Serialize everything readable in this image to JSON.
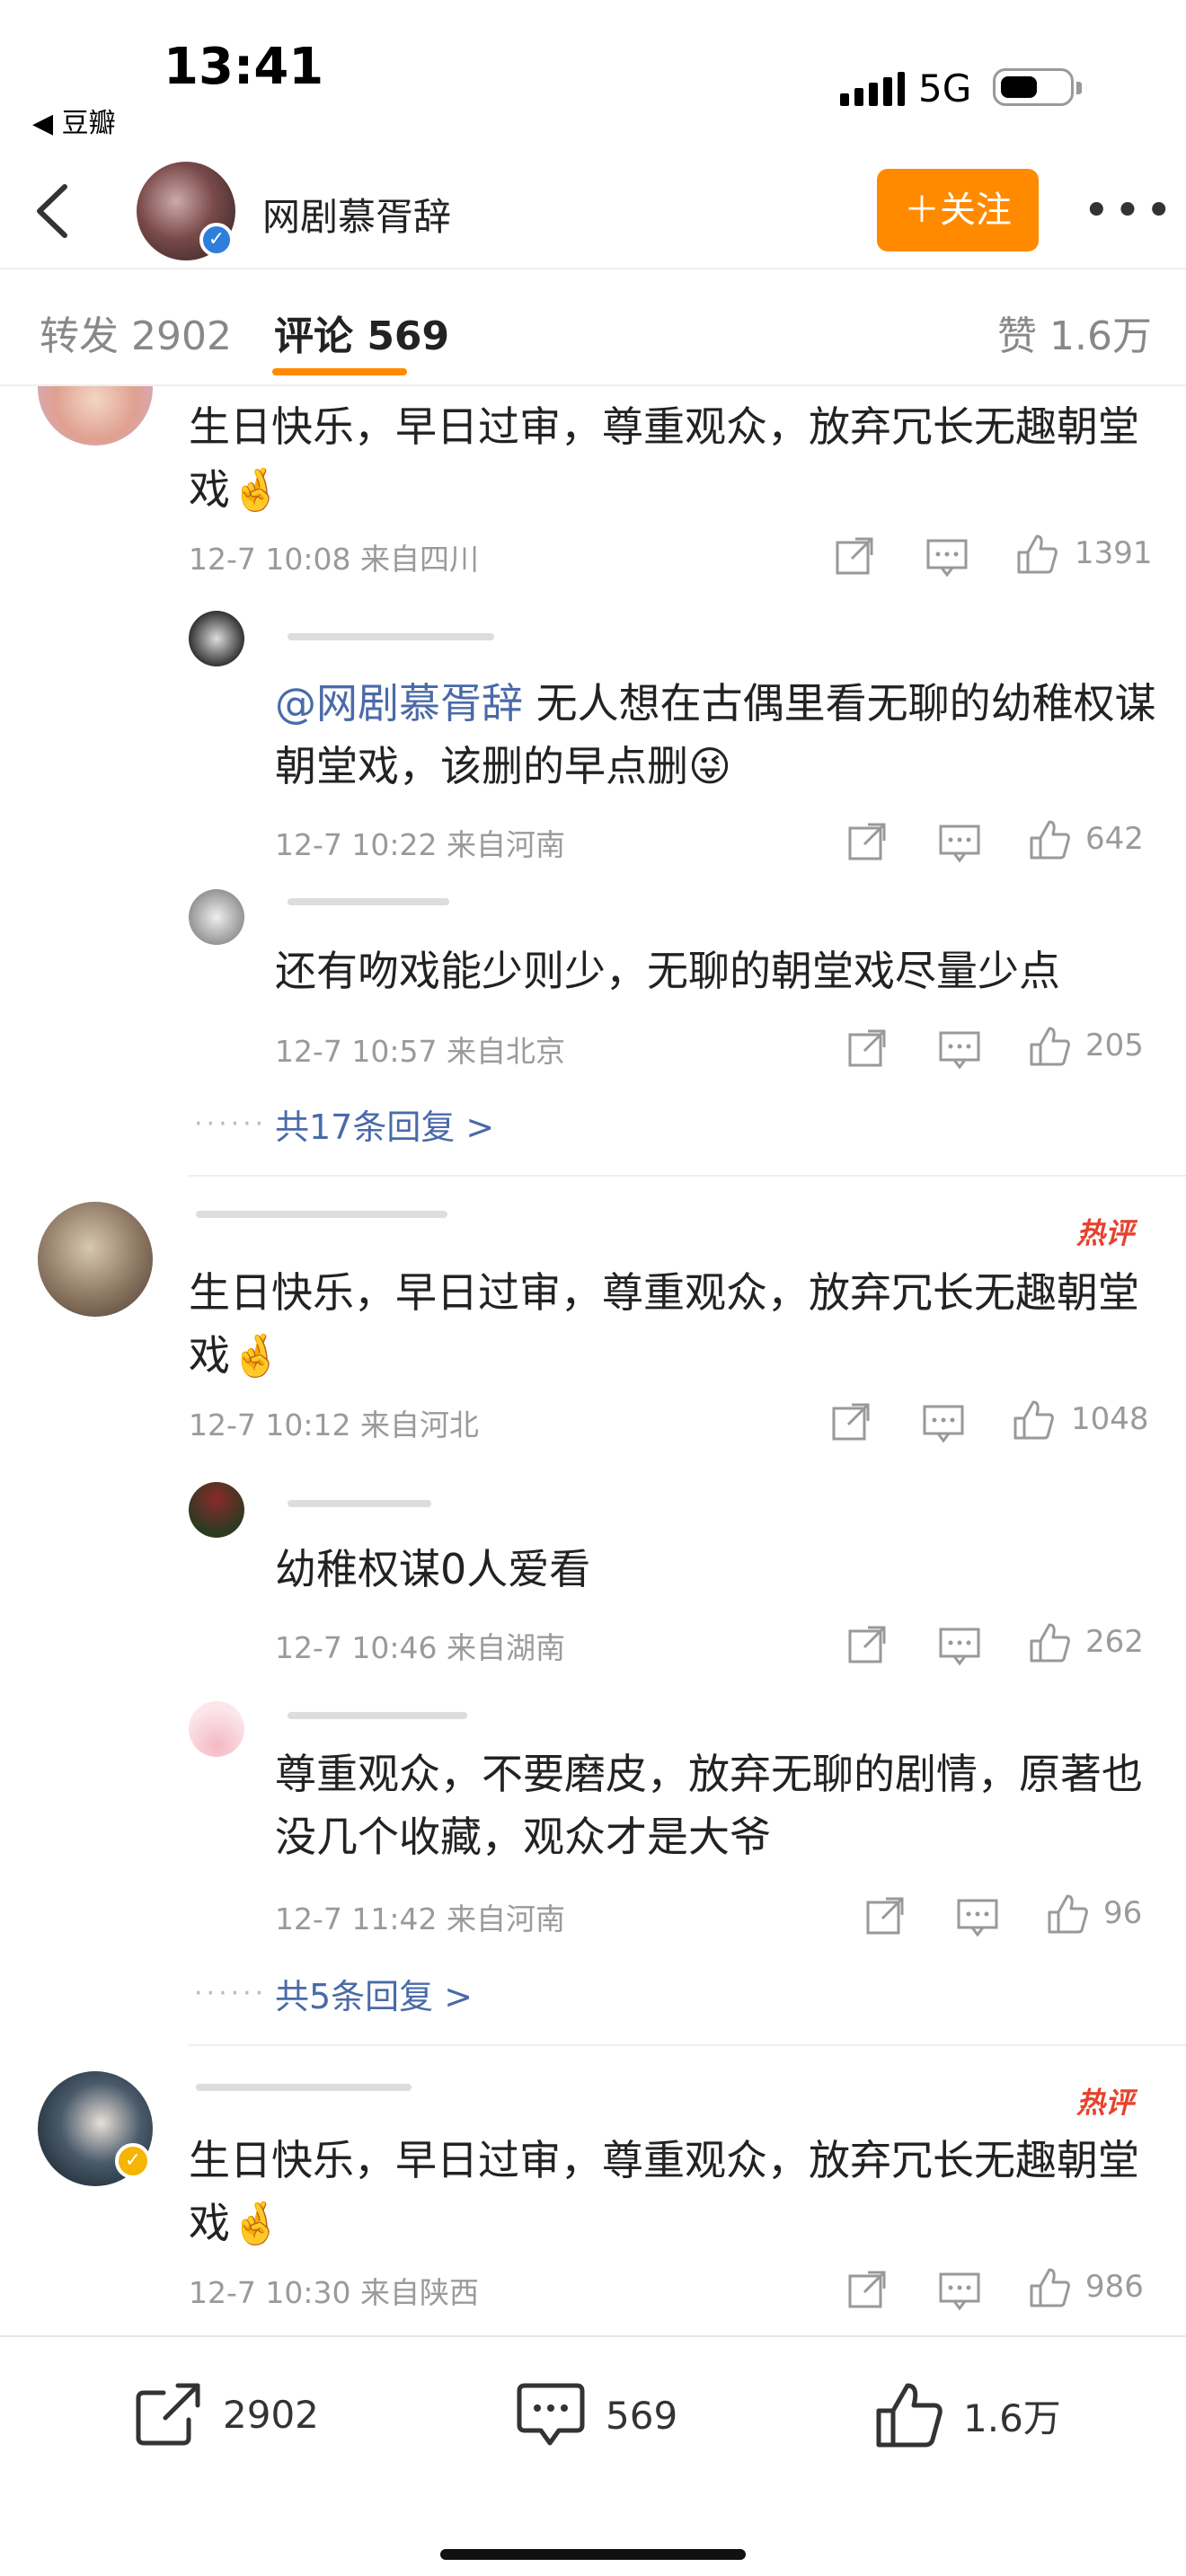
{
  "status_bar": {
    "time": "13:41",
    "back_app": "◀ 豆瓣",
    "network": "5G"
  },
  "nav": {
    "title": "网剧慕胥辞",
    "follow_label": "＋关注",
    "more_label": "•••"
  },
  "tabs": {
    "repost": "转发 2902",
    "comments": "评论 569",
    "likes": "赞 1.6万"
  },
  "comments": [
    {
      "text": "生日快乐，早日过审，尊重观众，放弃冗长无趣朝堂戏🤞",
      "meta": "12-7 10:08  来自四川",
      "likes": "1391",
      "replies": [
        {
          "mention": "@网剧慕胥辞",
          "text": " 无人想在古偶里看无聊的幼稚权谋朝堂戏，该删的早点删😜",
          "meta": "12-7 10:22  来自河南",
          "likes": "642"
        },
        {
          "mention": "",
          "text": "还有吻戏能少则少，无聊的朝堂戏尽量少点",
          "meta": "12-7 10:57  来自北京",
          "likes": "205"
        }
      ],
      "more_replies": "共17条回复 >"
    },
    {
      "hot": "热评",
      "text": "生日快乐，早日过审，尊重观众，放弃冗长无趣朝堂戏🤞",
      "meta": "12-7 10:12  来自河北",
      "likes": "1048",
      "replies": [
        {
          "mention": "",
          "text": "幼稚权谋0人爱看",
          "meta": "12-7 10:46  来自湖南",
          "likes": "262"
        },
        {
          "mention": "",
          "text": "尊重观众，不要磨皮，放弃无聊的剧情，原著也没几个收藏，观众才是大爷",
          "meta": "12-7 11:42  来自河南",
          "likes": "96"
        }
      ],
      "more_replies": "共5条回复 >"
    },
    {
      "hot": "热评",
      "text": "生日快乐，早日过审，尊重观众，放弃冗长无趣朝堂戏🤞",
      "meta": "12-7 10:30  来自陕西",
      "likes": "986"
    }
  ],
  "bottom_bar": {
    "reposts": "2902",
    "comments": "569",
    "likes": "1.6万"
  },
  "colors": {
    "accent": "#ff8a00",
    "link": "#4a6aa8",
    "hot": "#e8412c"
  }
}
